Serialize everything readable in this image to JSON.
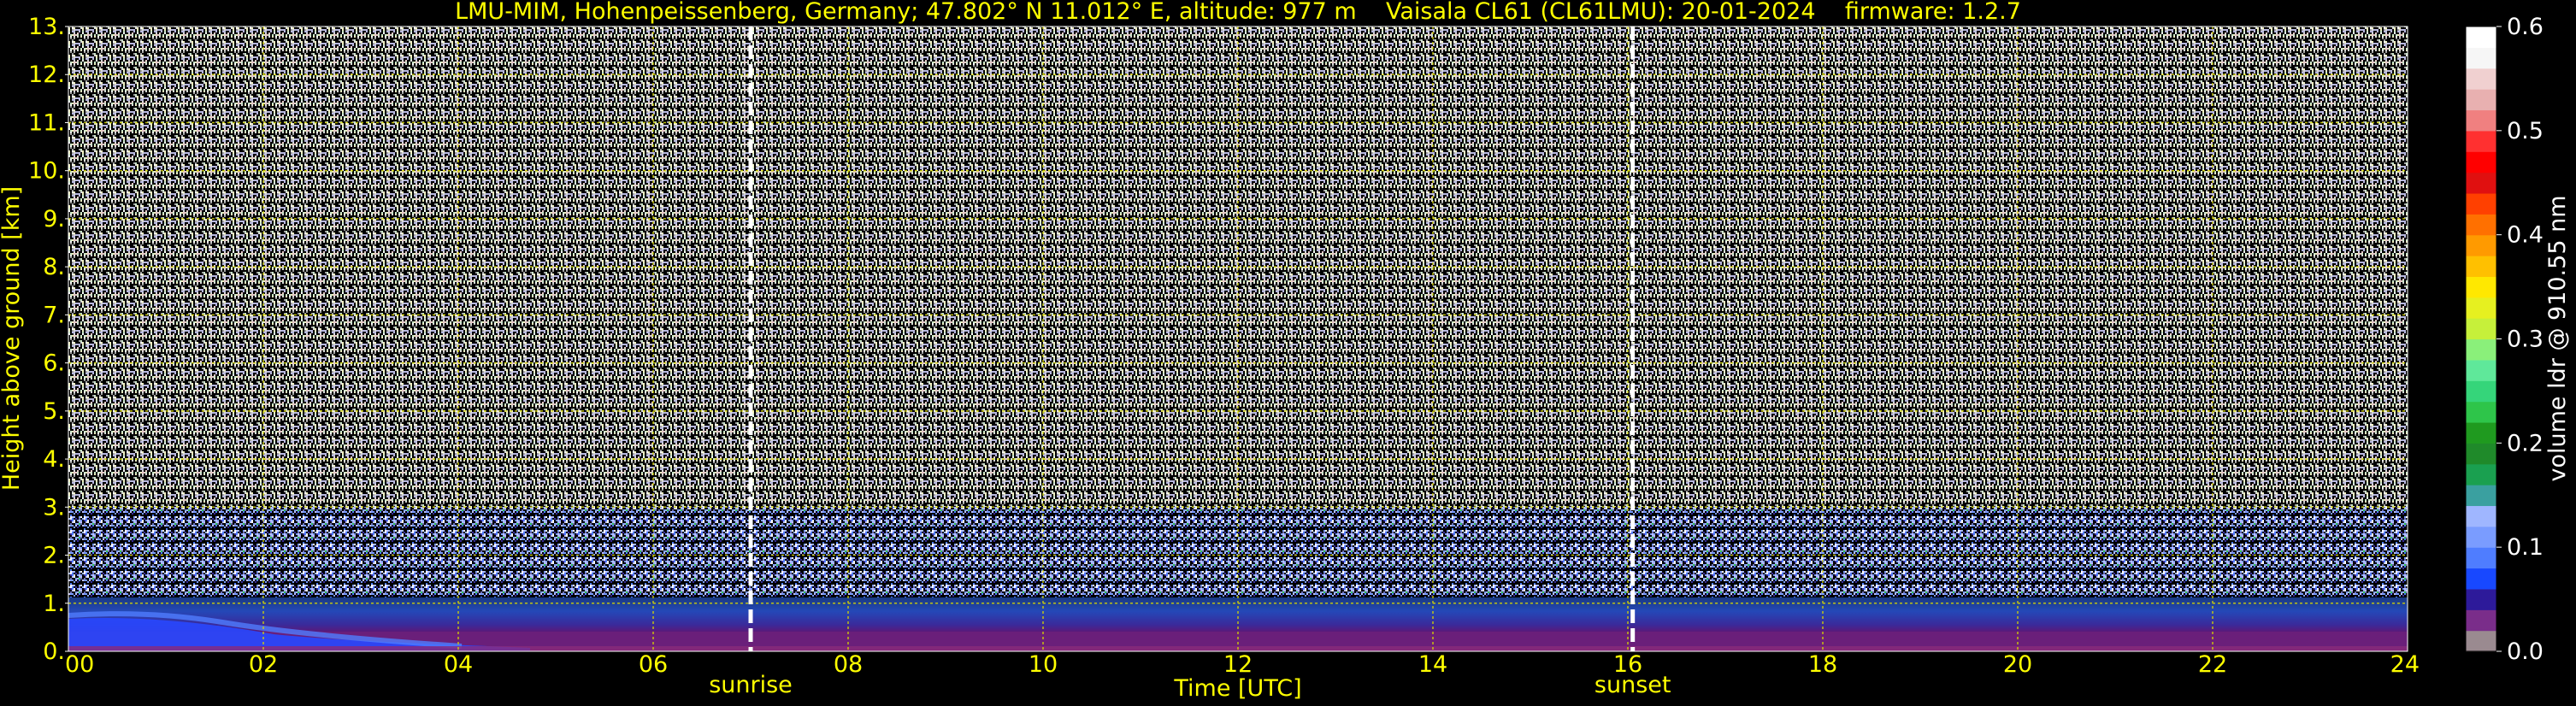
{
  "chart_data": {
    "type": "heatmap",
    "title": "LMU-MIM, Hohenpeissenberg, Germany; 47.802° N 11.012° E, altitude: 977 m    Vaisala CL61 (CL61LMU): 20-01-2024    firmware: 1.2.7",
    "xlabel": "Time [UTC]",
    "ylabel": "Height above ground [km]",
    "xlim": [
      0,
      24
    ],
    "ylim": [
      0,
      13
    ],
    "x_ticks": [
      "00",
      "02",
      "04",
      "06",
      "08",
      "10",
      "12",
      "14",
      "16",
      "18",
      "20",
      "22",
      "24"
    ],
    "y_ticks": [
      "0.",
      "1.",
      "2.",
      "3.",
      "4.",
      "5.",
      "6.",
      "7.",
      "8.",
      "9.",
      "10.",
      "11.",
      "12.",
      "13."
    ],
    "grid": true,
    "annotations": [
      {
        "label": "sunrise",
        "x": 7.0
      },
      {
        "label": "sunset",
        "x": 16.05
      }
    ],
    "colorbar": {
      "label": "volume ldr @ 910.55 nm",
      "range": [
        0.0,
        0.6
      ],
      "ticks": [
        "0.0",
        "0.1",
        "0.2",
        "0.3",
        "0.4",
        "0.5",
        "0.6"
      ],
      "colors": [
        "#9a8a90",
        "#7a2d8a",
        "#2d1a9a",
        "#1848ff",
        "#4f7dff",
        "#7a9cff",
        "#9fb6ff",
        "#3aa0a0",
        "#1aa050",
        "#1f8a2a",
        "#1f9a1f",
        "#2ec54a",
        "#35d57a",
        "#5fe89a",
        "#8af07a",
        "#c6f03a",
        "#e6f020",
        "#ffe800",
        "#ffc000",
        "#ff9a00",
        "#ff7000",
        "#ff4000",
        "#e01010",
        "#ff0000",
        "#ff3030",
        "#f08080",
        "#e8b0b0",
        "#f0d0d0",
        "#f6f6f6",
        "#ffffff"
      ]
    },
    "layers": [
      {
        "name": "noise",
        "y_range": [
          3,
          13
        ],
        "density": "high"
      },
      {
        "name": "noisy-blue-green",
        "y_range": [
          1,
          3
        ]
      },
      {
        "name": "blue",
        "y_range": [
          0.4,
          1
        ]
      },
      {
        "name": "purple",
        "y_range": [
          0,
          0.4
        ]
      }
    ]
  }
}
